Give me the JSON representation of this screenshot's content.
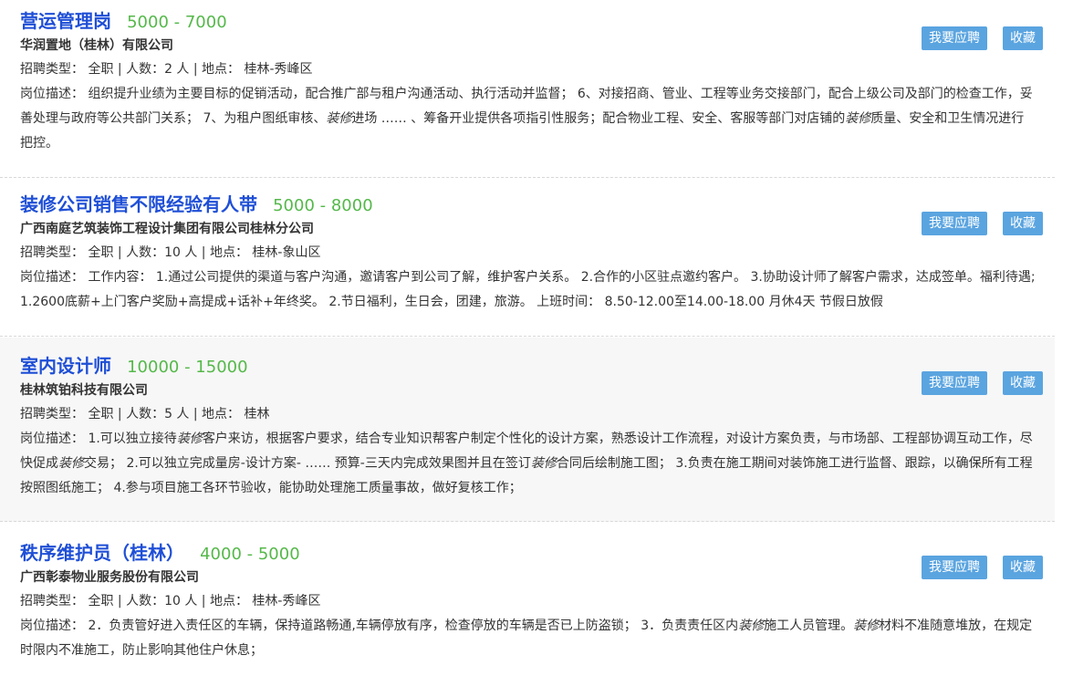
{
  "buttons": {
    "apply": "我要应聘",
    "favorite": "收藏"
  },
  "jobs": [
    {
      "title": "营运管理岗",
      "salary": "5000 - 7000",
      "company": "华润置地（桂林）有限公司",
      "meta": "招聘类型：  全职 | 人数：2 人 | 地点：  桂林-秀峰区",
      "desc": [
        {
          "t": "岗位描述：  组织提升业绩为主要目标的促销活动，配合推广部与租户沟通活动、执行活动并监督；  6、对接招商、管业、工程等业务交接部门，配合上级公司及部门的检查工作，妥善处理与政府等公共部门关系；  7、为租户图纸审核、"
        },
        {
          "t": "装修",
          "kw": true
        },
        {
          "t": "进场 …… 、筹备开业提供各项指引性服务；配合物业工程、安全、客服等部门对店铺的"
        },
        {
          "t": "装修",
          "kw": true
        },
        {
          "t": "质量、安全和卫生情况进行把控。"
        }
      ]
    },
    {
      "title": "装修公司销售不限经验有人带",
      "salary": "5000 - 8000",
      "company": "广西南庭艺筑装饰工程设计集团有限公司桂林分公司",
      "meta": "招聘类型：  全职 | 人数：10 人 | 地点：  桂林-象山区",
      "desc": [
        {
          "t": "岗位描述：  工作内容：  1.通过公司提供的渠道与客户沟通，邀请客户到公司了解，维护客户关系。  2.合作的小区驻点邀约客户。  3.协助设计师了解客户需求，达成签单。福利待遇; 1.2600底薪+上门客户奖励+高提成+话补+年终奖。  2.节日福利，生日会，团建，旅游。  上班时间：  8.50-12.00至14.00-18.00 月休4天 节假日放假"
        }
      ]
    },
    {
      "title": "室内设计师",
      "salary": "10000 - 15000",
      "company": "桂林筑铂科技有限公司",
      "meta": "招聘类型：  全职 | 人数：5 人 | 地点：  桂林",
      "desc": [
        {
          "t": "岗位描述：  1.可以独立接待"
        },
        {
          "t": "装修",
          "kw": true
        },
        {
          "t": "客户来访，根据客户要求，结合专业知识帮客户制定个性化的设计方案，熟悉设计工作流程，对设计方案负责，与市场部、工程部协调互动工作，尽快促成"
        },
        {
          "t": "装修",
          "kw": true
        },
        {
          "t": "交易；  2.可以独立完成量房-设计方案- …… 预算-三天内完成效果图并且在签订"
        },
        {
          "t": "装修",
          "kw": true
        },
        {
          "t": "合同后绘制施工图；  3.负责在施工期间对装饰施工进行监督、跟踪，以确保所有工程按照图纸施工；  4.参与项目施工各环节验收，能协助处理施工质量事故，做好复核工作；"
        }
      ]
    },
    {
      "title": "秩序维护员（桂林）",
      "salary": "4000 - 5000",
      "company": "广西彰泰物业服务股份有限公司",
      "meta": "招聘类型：  全职 | 人数：10 人 | 地点：  桂林-秀峰区",
      "desc": [
        {
          "t": "岗位描述：  2．负责管好进入责任区的车辆，保持道路畅通,车辆停放有序，检查停放的车辆是否已上防盗锁；  3．负责责任区内"
        },
        {
          "t": "装修",
          "kw": true
        },
        {
          "t": "施工人员管理。"
        },
        {
          "t": "装修",
          "kw": true
        },
        {
          "t": "材料不准随意堆放，在规定时限内不准施工，防止影响其他住户休息；"
        }
      ]
    }
  ]
}
